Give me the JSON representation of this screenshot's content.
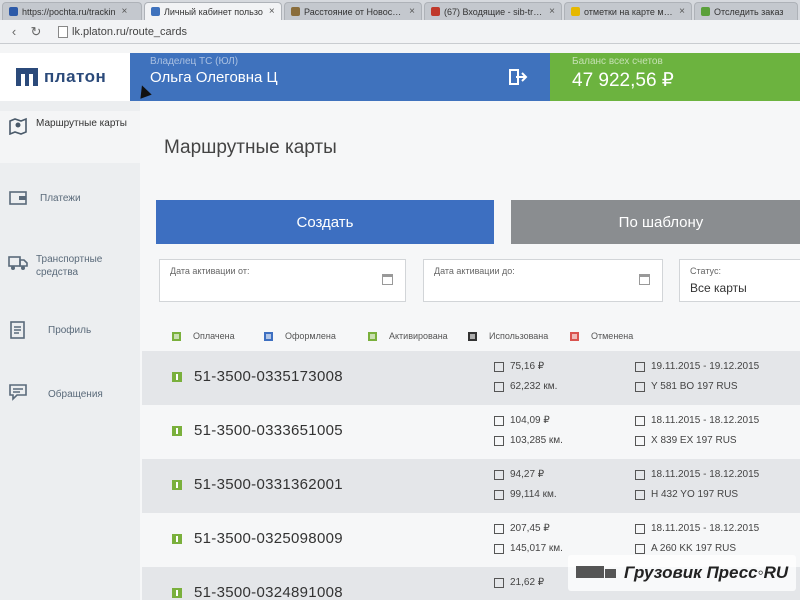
{
  "browser": {
    "tabs": [
      {
        "label": "https://pochta.ru/trackin",
        "color": "#2d5aa8",
        "active": false
      },
      {
        "label": "Личный кабинет пользо",
        "color": "#3f72bd",
        "active": true
      },
      {
        "label": "Расстояние от Новосиби",
        "color": "#8a6d3b",
        "active": false
      },
      {
        "label": "(67) Входящие - sib-truck",
        "color": "#c0392b",
        "active": false
      },
      {
        "label": "отметки на карте мест сл",
        "color": "#e6b800",
        "active": false
      },
      {
        "label": "Отследить заказ",
        "color": "#5ba03a",
        "active": false
      }
    ],
    "url": "lk.platon.ru/route_cards"
  },
  "header": {
    "logo": "платон",
    "user_role": "Владелец ТС (ЮЛ)",
    "user_name": "Ольга Олеговна Ц",
    "balance_label": "Баланс всех счетов",
    "balance_value": "47 922,56 ₽"
  },
  "sidebar": {
    "items": [
      {
        "label": "Маршрутные карты",
        "icon": "map-pin-icon",
        "active": true
      },
      {
        "label": "Платежи",
        "icon": "wallet-icon",
        "active": false
      },
      {
        "label": "Транспортные средства",
        "icon": "truck-icon",
        "active": false
      },
      {
        "label": "Профиль",
        "icon": "profile-icon",
        "active": false
      },
      {
        "label": "Обращения",
        "icon": "message-icon",
        "active": false
      }
    ]
  },
  "main": {
    "title": "Маршрутные карты",
    "create_label": "Создать",
    "template_label": "По шаблону",
    "filter_from_label": "Дата активации от:",
    "filter_to_label": "Дата активации до:",
    "status_label": "Статус:",
    "status_value": "Все карты",
    "legend": [
      {
        "label": "Оплачена",
        "color": "#7ab03c"
      },
      {
        "label": "Оформлена",
        "color": "#3d6fc1"
      },
      {
        "label": "Активирована",
        "color": "#7ab03c"
      },
      {
        "label": "Использована",
        "color": "#333333"
      },
      {
        "label": "Отменена",
        "color": "#d9534f"
      }
    ],
    "cards": [
      {
        "number": "51-3500-0335173008",
        "price": "75,16 ₽",
        "distance": "62,232 км.",
        "dates": "19.11.2015 - 19.12.2015",
        "plate": "Y 581 BO 197 RUS"
      },
      {
        "number": "51-3500-0333651005",
        "price": "104,09 ₽",
        "distance": "103,285 км.",
        "dates": "18.11.2015 - 18.12.2015",
        "plate": "X 839 EX 197 RUS"
      },
      {
        "number": "51-3500-0331362001",
        "price": "94,27 ₽",
        "distance": "99,114 км.",
        "dates": "18.11.2015 - 18.12.2015",
        "plate": "H 432 YO 197 RUS"
      },
      {
        "number": "51-3500-0325098009",
        "price": "207,45 ₽",
        "distance": "145,017 км.",
        "dates": "18.11.2015 - 18.12.2015",
        "plate": "A 260 KK 197 RUS"
      },
      {
        "number": "51-3500-0324891008",
        "price": "21,62 ₽",
        "distance": "",
        "dates": "",
        "plate": ""
      }
    ]
  },
  "watermark": "Грузовик Пресс◦RU"
}
